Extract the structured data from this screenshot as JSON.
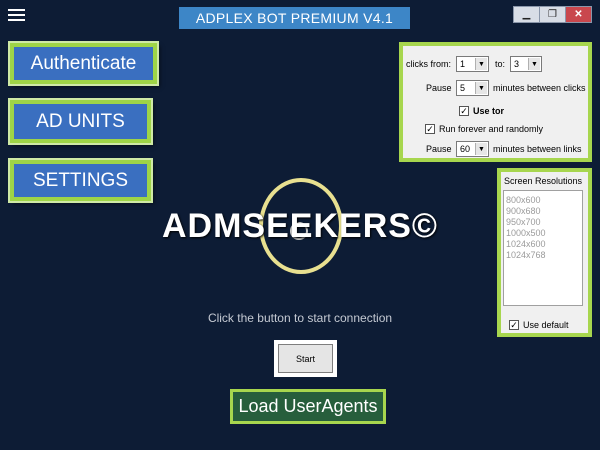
{
  "window": {
    "title": "ADPLEX BOT PREMIUM V4.1",
    "controls": {
      "minimize": "▁",
      "maximize": "❐",
      "close": "✕"
    }
  },
  "nav": {
    "authenticate": "Authenticate",
    "ad_units": "AD UNITS",
    "settings": "SETTINGS"
  },
  "settings_panel": {
    "clicks_from_label": "clicks from:",
    "clicks_from_value": "1",
    "to_label": "to:",
    "to_value": "3",
    "pause_label": "Pause",
    "pause_value": "5",
    "pause_suffix": "minutes between clicks",
    "use_tor_label": "Use tor",
    "use_tor_checked": true,
    "run_forever_label": "Run forever and randomly",
    "run_forever_checked": true,
    "pause2_label": "Pause",
    "pause2_value": "60",
    "pause2_suffix": "minutes between links"
  },
  "resolutions": {
    "title": "Screen Resolutions",
    "items": [
      "800x600",
      "900x680",
      "950x700",
      "1000x500",
      "1024x600",
      "1024x768"
    ],
    "use_default_label": "Use default",
    "use_default_checked": true
  },
  "main": {
    "brand": "ADMSEEKERS©",
    "hint": "Click the button to start connection",
    "start_label": "Start",
    "load_label": "Load UserAgents"
  },
  "colors": {
    "background": "#0d1c35",
    "title_bar": "#3d86c7",
    "nav_button": "#3a6fc0",
    "accent_border": "#9ed447",
    "load_button": "#275e3c"
  }
}
